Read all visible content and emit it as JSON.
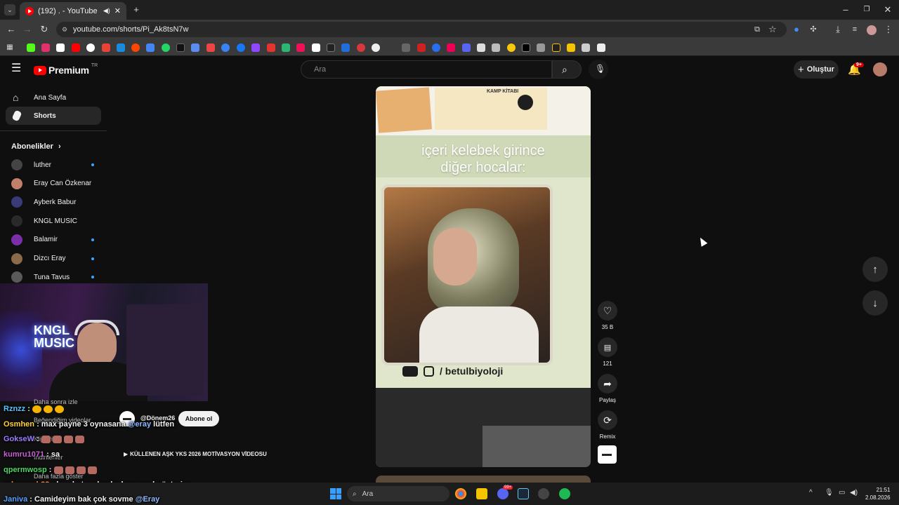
{
  "browser": {
    "tab_title": "(192) . - YouTube",
    "url": "youtube.com/shorts/Pi_Ak8tsN7w",
    "new_tab": "+"
  },
  "youtube": {
    "logo_text": "Premium",
    "logo_region": "TR",
    "search_placeholder": "Ara",
    "create_label": "Oluştur",
    "notification_count": "9+"
  },
  "sidebar": {
    "home": "Ana Sayfa",
    "shorts": "Shorts",
    "subscriptions_title": "Abonelikler",
    "subscriptions": [
      {
        "name": "luther",
        "color": "#444444",
        "new": true
      },
      {
        "name": "Eray Can Özkenar",
        "color": "#c0806a",
        "new": false
      },
      {
        "name": "Ayberk Babur",
        "color": "#3a3a7a",
        "new": false
      },
      {
        "name": "KNGL MUSIC",
        "color": "#2a2a2a",
        "new": false
      },
      {
        "name": "Balamir",
        "color": "#7a2ea8",
        "new": true
      },
      {
        "name": "Dizcı Eray",
        "color": "#8a6a4a",
        "new": true
      },
      {
        "name": "Tuna Tavus",
        "color": "#5a5a5a",
        "new": true
      }
    ],
    "hidden_items": [
      "Daha sonra izle",
      "Beğendiğim videolar",
      "Klipleriniz",
      "İndirilenler",
      "Daha fazla göster"
    ]
  },
  "short": {
    "overlay_text_line1": "içeri kelebek girince",
    "overlay_text_line2": "diğer hocalar:",
    "social_handle": "/ betulbiyoloji",
    "banner_text": "KAMP KİTABI",
    "channel_handle": "@Dönem26",
    "subscribe_label": "Abone ol",
    "title": "KÜLLENEN AŞK YKS 2026 MOTİVASYON VİDEOSU"
  },
  "actions": {
    "likes": "35 B",
    "comments": "121",
    "share": "Paylaş",
    "remix": "Remix"
  },
  "stream_overlay": {
    "logo_line1": "KNGL",
    "logo_line2": "MUSIC",
    "chat": [
      {
        "user": "Rznzz",
        "msg": "",
        "color": "#59c4ff"
      },
      {
        "user": "Osmhen",
        "msg": "max payne 3 oynasana",
        "mention": "@eray",
        "tail": "lütfen",
        "color": "#ffd23f"
      },
      {
        "user": "GokseW",
        "msg": "",
        "color": "#9b7bff"
      },
      {
        "user": "kumru1071",
        "msg": "sa",
        "color": "#c85fd6"
      },
      {
        "user": "qpermwosp",
        "msg": "",
        "color": "#4cd964"
      },
      {
        "user": "orhanmyb33",
        "msg": "bu chat ne kanka ben nasıl göstericе",
        "color": "#ff8a3d"
      },
      {
        "user": "Janiva",
        "msg": "Camideyim bak çok sovme",
        "mention": "@Eray",
        "color": "#5aa0ff"
      }
    ]
  },
  "taskbar": {
    "search": "Ara",
    "time": "21:51",
    "date": "2.08.2026",
    "discord_badge": "99+"
  }
}
